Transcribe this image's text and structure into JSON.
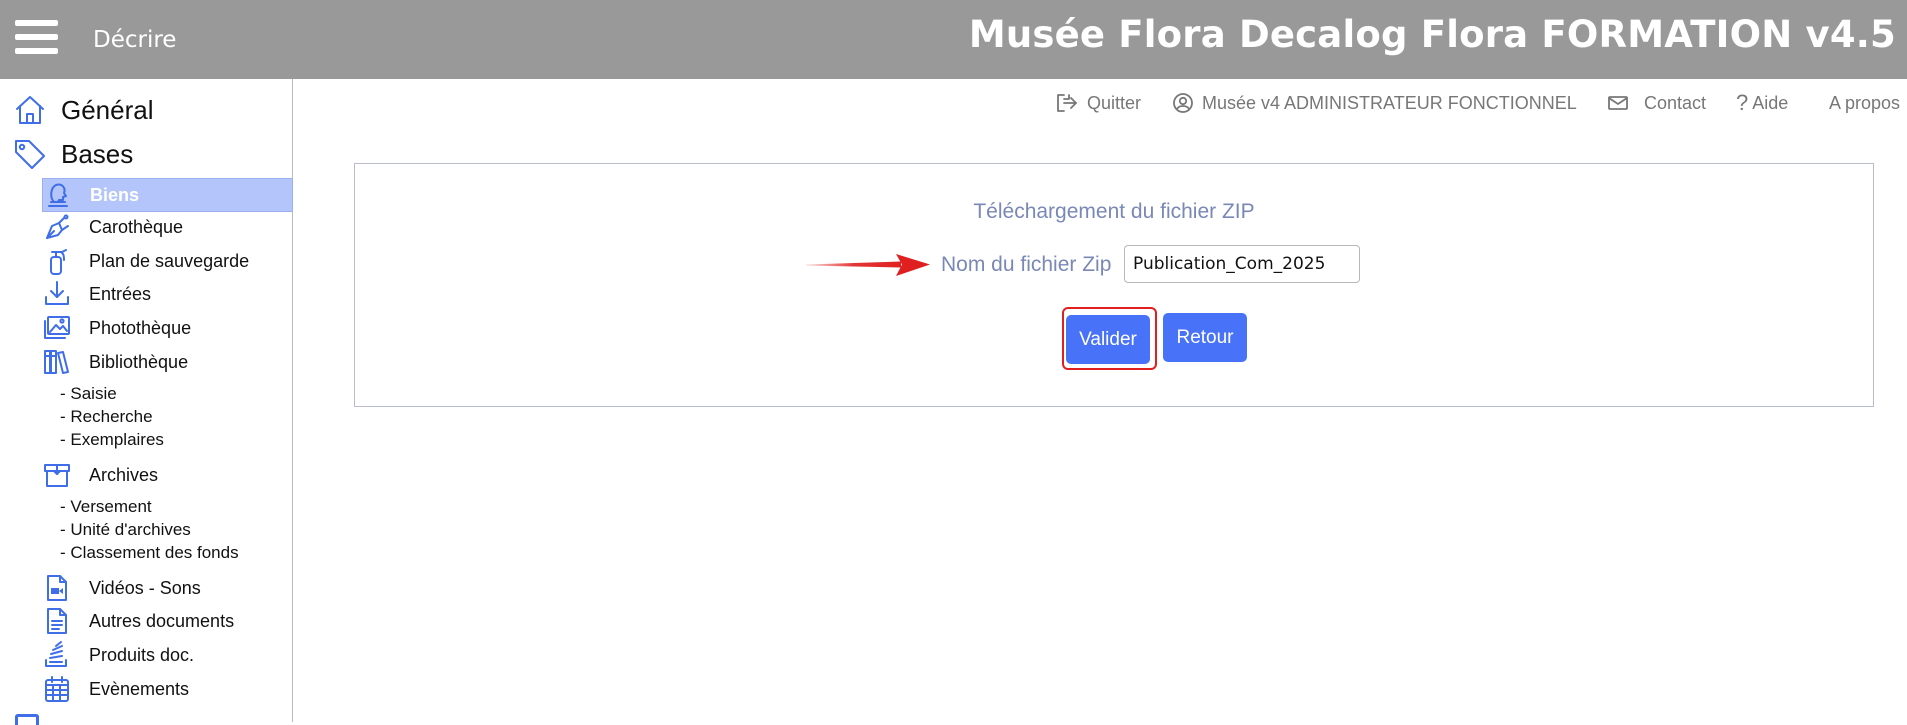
{
  "header": {
    "menu_icon": "hamburger-menu-icon",
    "section": "Décrire",
    "app_title": "Musée Flora Decalog Flora FORMATION v4.5"
  },
  "top_links": {
    "quit": "Quitter",
    "user": "Musée v4 ADMINISTRATEUR FONCTIONNEL",
    "contact": "Contact",
    "help": "Aide",
    "about": "A propos"
  },
  "sidebar": {
    "general": "Général",
    "bases": "Bases",
    "items": [
      {
        "label": "Biens",
        "icon": "bust-icon",
        "active": true
      },
      {
        "label": "Carothèque",
        "icon": "pen-nib-icon"
      },
      {
        "label": "Plan de sauvegarde",
        "icon": "fire-extinguisher-icon"
      },
      {
        "label": "Entrées",
        "icon": "download-tray-icon"
      },
      {
        "label": "Photothèque",
        "icon": "images-icon"
      },
      {
        "label": "Bibliothèque",
        "icon": "books-icon"
      }
    ],
    "library_sub": [
      "- Saisie",
      "- Recherche",
      "- Exemplaires"
    ],
    "archives": {
      "label": "Archives",
      "icon": "open-box-icon"
    },
    "archives_sub": [
      "- Versement",
      "- Unité d'archives",
      "- Classement des fonds"
    ],
    "items2": [
      {
        "label": "Vidéos - Sons",
        "icon": "video-file-icon"
      },
      {
        "label": "Autres documents",
        "icon": "document-icon"
      },
      {
        "label": "Produits doc.",
        "icon": "stack-icon"
      },
      {
        "label": "Evènements",
        "icon": "calendar-icon"
      }
    ]
  },
  "form": {
    "title": "Téléchargement du fichier ZIP",
    "field_label": "Nom du fichier Zip",
    "field_value": "Publication_Com_2025",
    "submit_label": "Valider",
    "back_label": "Retour"
  },
  "colors": {
    "header_bg": "#999999",
    "accent": "#4872f7",
    "active_item": "#b3c5fa",
    "label_text": "#7a88b6",
    "annotation": "#e02020"
  }
}
